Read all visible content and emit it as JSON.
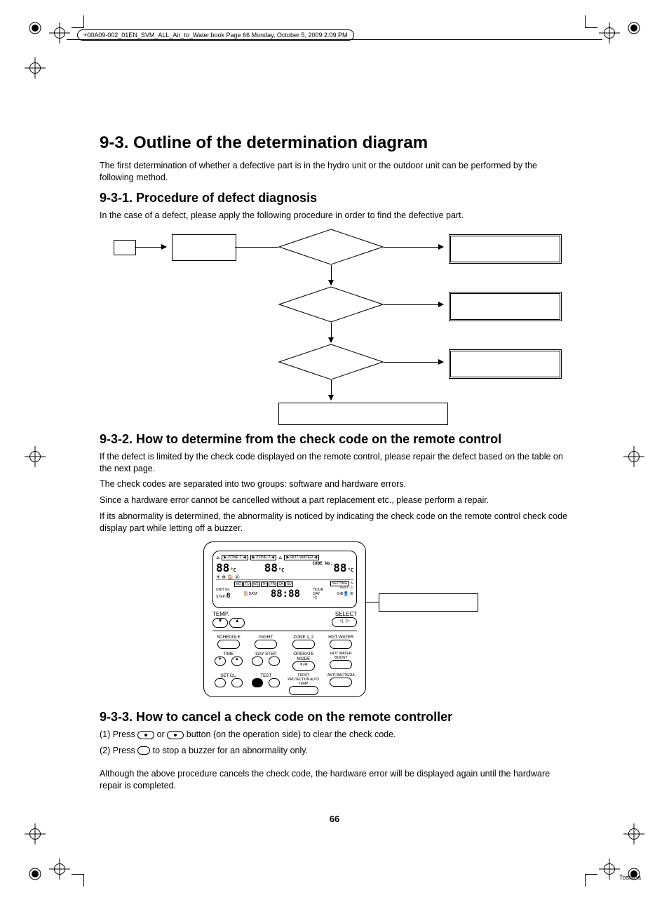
{
  "running_head": "+00A09-002_01EN_SVM_ALL_Air_to_Water.book  Page 66  Monday, October 5, 2009  2:09 PM",
  "page_number": "66",
  "footer_brand": "Toshiba",
  "section": {
    "title": "9-3.  Outline of the determination diagram",
    "intro": "The first determination of whether a defective part is in the hydro unit or the outdoor unit can be performed by the following method."
  },
  "sub1": {
    "title": "9-3-1.  Procedure of defect diagnosis",
    "text": "In the case of a defect, please apply the following procedure in order to find the defective part."
  },
  "sub2": {
    "title": "9-3-2.  How to determine from the check code on the remote control",
    "p1": "If the defect is limited by the check code displayed on the remote control, please repair the defect based on the table on the next page.",
    "p2": "The check codes are separated into two groups: software and hardware errors.",
    "p3": "Since a hardware error cannot be cancelled without a part replacement etc., please perform a repair.",
    "p4": "If its abnormality is determined, the abnormality is noticed by indicating the check code on the remote control check code display part while letting off a buzzer."
  },
  "sub3": {
    "title": "9-3-3.  How to cancel a check code on the remote controller",
    "step1_a": "(1) Press ",
    "step1_b": " or ",
    "step1_c": " button (on the operation side) to clear the check code.",
    "step2_a": "(2) Press ",
    "step2_b": " to stop a buzzer for an abnormality only.",
    "note": "Although the above procedure cancels the check code, the hardware error will be displayed again until the hardware repair is completed."
  },
  "remote": {
    "lcd": {
      "zone1": "ZONE 1",
      "zone2": "ZONE 2",
      "hotwater": "HOT WATER",
      "seg": "88",
      "c": "°C",
      "code": "CODE No.",
      "days": [
        "MO",
        "TU",
        "WE",
        "TH",
        "FR",
        "SA",
        "SU"
      ],
      "time": "88:88",
      "hour": "HOUR",
      "day": "DAY",
      "unit": "UNIT No.",
      "step": "STEP",
      "data": "DATA",
      "setting": "SETTING",
      "test": "TEST"
    },
    "row2": {
      "temp": "TEMP.",
      "select": "SELECT"
    },
    "buttons": {
      "r1": [
        "SCHEDULE",
        "NIGHT",
        "ZONE 1, 2",
        "HOT WATER"
      ],
      "r2": [
        "TIME",
        "DAY  STEP",
        "OPERATE MODE",
        "HOT WATER BOOST"
      ],
      "r3": [
        "SET    CL.",
        "TEST",
        "FROST PROTECTION  AUTO TEMP.",
        "ANTI BACTERIA"
      ]
    }
  }
}
